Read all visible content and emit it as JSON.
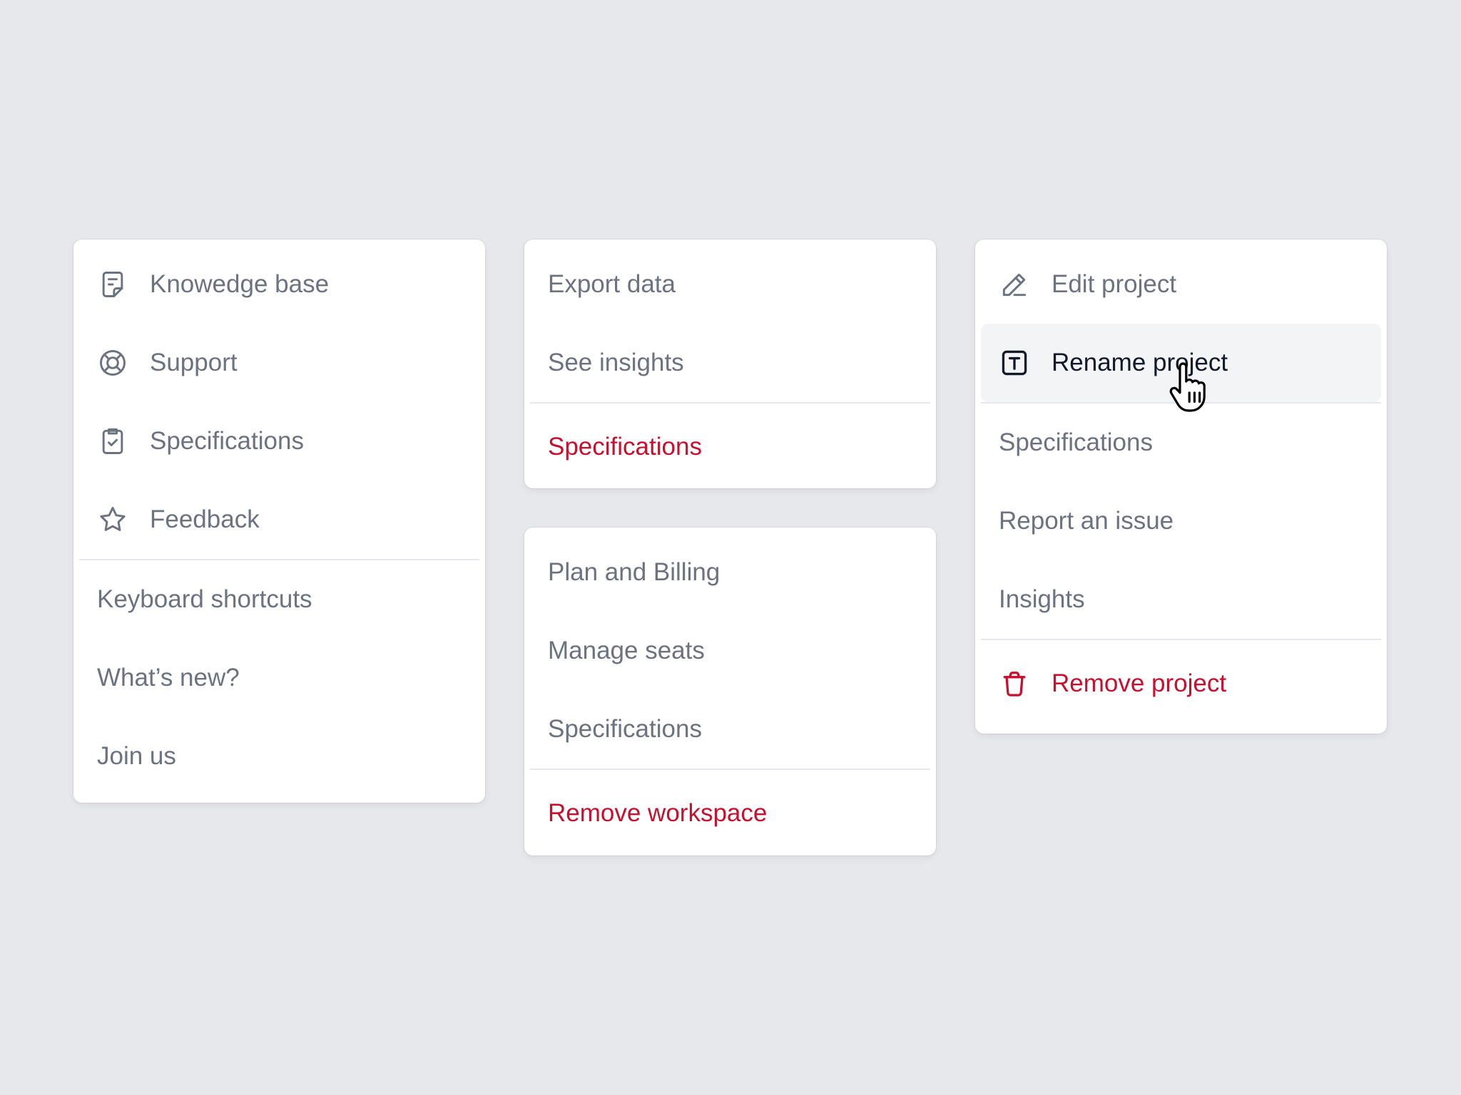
{
  "colors": {
    "background": "#e7e8ec",
    "text": "#6b7280",
    "danger": "#c8102e",
    "hover_bg": "#f3f4f6",
    "hover_text": "#111827"
  },
  "help_menu": {
    "items": [
      {
        "label": "Knowedge base",
        "icon": "document-icon"
      },
      {
        "label": "Support",
        "icon": "lifebuoy-icon"
      },
      {
        "label": "Specifications",
        "icon": "clipboard-check-icon"
      },
      {
        "label": "Feedback",
        "icon": "star-icon"
      }
    ],
    "links": [
      {
        "label": "Keyboard shortcuts"
      },
      {
        "label": "What’s new?"
      },
      {
        "label": "Join us"
      }
    ]
  },
  "data_menu": {
    "items": [
      {
        "label": "Export data"
      },
      {
        "label": "See insights"
      }
    ],
    "danger_item": {
      "label": "Specifications"
    }
  },
  "billing_menu": {
    "items": [
      {
        "label": "Plan and Billing"
      },
      {
        "label": "Manage seats"
      },
      {
        "label": "Specifications"
      }
    ],
    "danger_item": {
      "label": "Remove workspace"
    }
  },
  "project_menu": {
    "items": [
      {
        "label": "Edit project",
        "icon": "pencil-icon"
      },
      {
        "label": "Rename project",
        "icon": "text-box-icon",
        "state": "hovered"
      }
    ],
    "more": [
      {
        "label": "Specifications"
      },
      {
        "label": "Report an issue"
      },
      {
        "label": "Insights"
      }
    ],
    "danger_item": {
      "label": "Remove project",
      "icon": "trash-icon"
    }
  },
  "cursor": {
    "icon": "hand-pointer-icon"
  }
}
